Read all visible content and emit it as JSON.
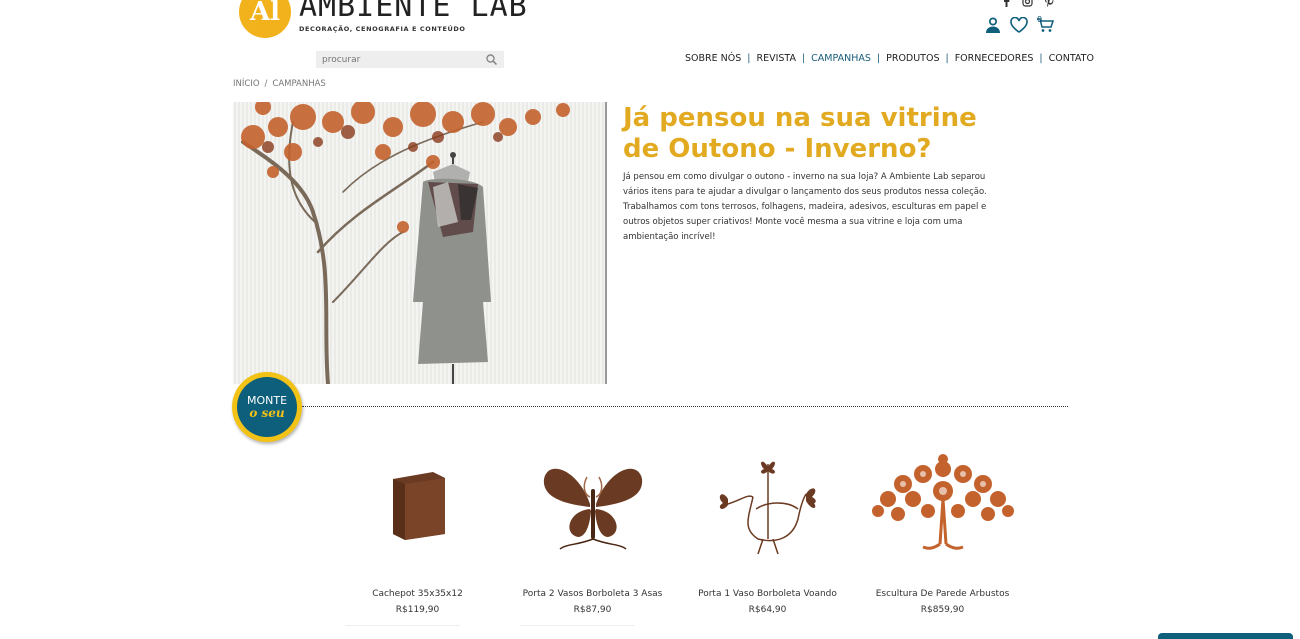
{
  "brand": {
    "mark": "Al",
    "name": "AMBIENTE LAB",
    "tagline": "DECORAÇÃO, CENOGRAFIA E CONTEÚDO",
    "color": "#f2b21b"
  },
  "social": [
    "facebook-icon",
    "instagram-icon",
    "pinterest-icon"
  ],
  "header_icons": {
    "cart_count": "0"
  },
  "search": {
    "placeholder": "procurar"
  },
  "nav": [
    {
      "label": "SOBRE NÓS",
      "active": false
    },
    {
      "label": "REVISTA",
      "active": false
    },
    {
      "label": "CAMPANHAS",
      "active": true
    },
    {
      "label": "PRODUTOS",
      "active": false
    },
    {
      "label": "FORNECEDORES",
      "active": false
    },
    {
      "label": "CONTATO",
      "active": false
    }
  ],
  "breadcrumb": {
    "home": "INÍCIO",
    "separator": "/",
    "current": "CAMPANHAS"
  },
  "hero": {
    "title": "Já pensou na sua vitrine de Outono - Inverno?",
    "text": "Já pensou em como divulgar o outono - inverno na sua loja? A Ambiente Lab separou vários itens para te ajudar a divulgar o lançamento dos seus produtos nessa coleção. Trabalhamos com tons terrosos, folhagens, madeira, adesivos, esculturas em papel e outros objetos super criativos! Monte você mesma a sua vitrine e loja com uma ambientação incrível!",
    "title_color": "#e2aa21"
  },
  "badge": {
    "line1": "MONTE",
    "line2": "o seu"
  },
  "products": [
    {
      "name": "Cachepot 35x35x12",
      "price": "R$119,90"
    },
    {
      "name": "Porta 2 Vasos Borboleta 3 Asas",
      "price": "R$87,90"
    },
    {
      "name": "Porta 1 Vaso Borboleta Voando",
      "price": "R$64,90"
    },
    {
      "name": "Escultura De Parede Arbustos",
      "price": "R$859,90"
    }
  ],
  "colors": {
    "accent": "#0e5f7c",
    "brown": "#6b3a22",
    "rust": "#c4622d"
  }
}
